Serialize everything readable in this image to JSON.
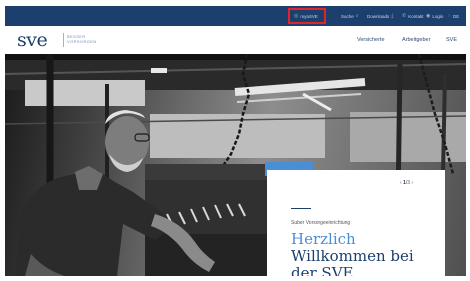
{
  "topbar": {
    "items": [
      {
        "icon": "globe-icon",
        "glyph": "◎",
        "label": "myaSVE"
      },
      {
        "icon": "search-icon",
        "glyph": "⌕",
        "label": "Suche"
      },
      {
        "icon": "download-icon",
        "glyph": "⤓",
        "label": "Downloads"
      },
      {
        "icon": "phone-icon",
        "glyph": "✆",
        "label": "Kontakt"
      },
      {
        "icon": "user-icon",
        "glyph": "◉",
        "label": "Login"
      },
      {
        "icon": "language-icon",
        "glyph": "◌",
        "label": "DE"
      }
    ]
  },
  "header": {
    "logo": "SVE",
    "tagline_line1": "BESSER",
    "tagline_line2": "VORSORGEN",
    "nav": [
      "Versicherte",
      "Arbeitgeber",
      "SVE"
    ]
  },
  "hero": {
    "pager": {
      "prev": "‹",
      "current": "1",
      "sep": "/",
      "total": "3",
      "next": "›"
    },
    "kicker": "Suber Vorsorgeeinrichtung",
    "heading_blue": "Herzlich",
    "heading_line2": "Willkommen bei",
    "heading_line3": "der SVE"
  },
  "colors": {
    "brand_navy": "#1c3f6e",
    "accent_blue": "#4a8fd6",
    "highlight_red": "#e0262d"
  }
}
